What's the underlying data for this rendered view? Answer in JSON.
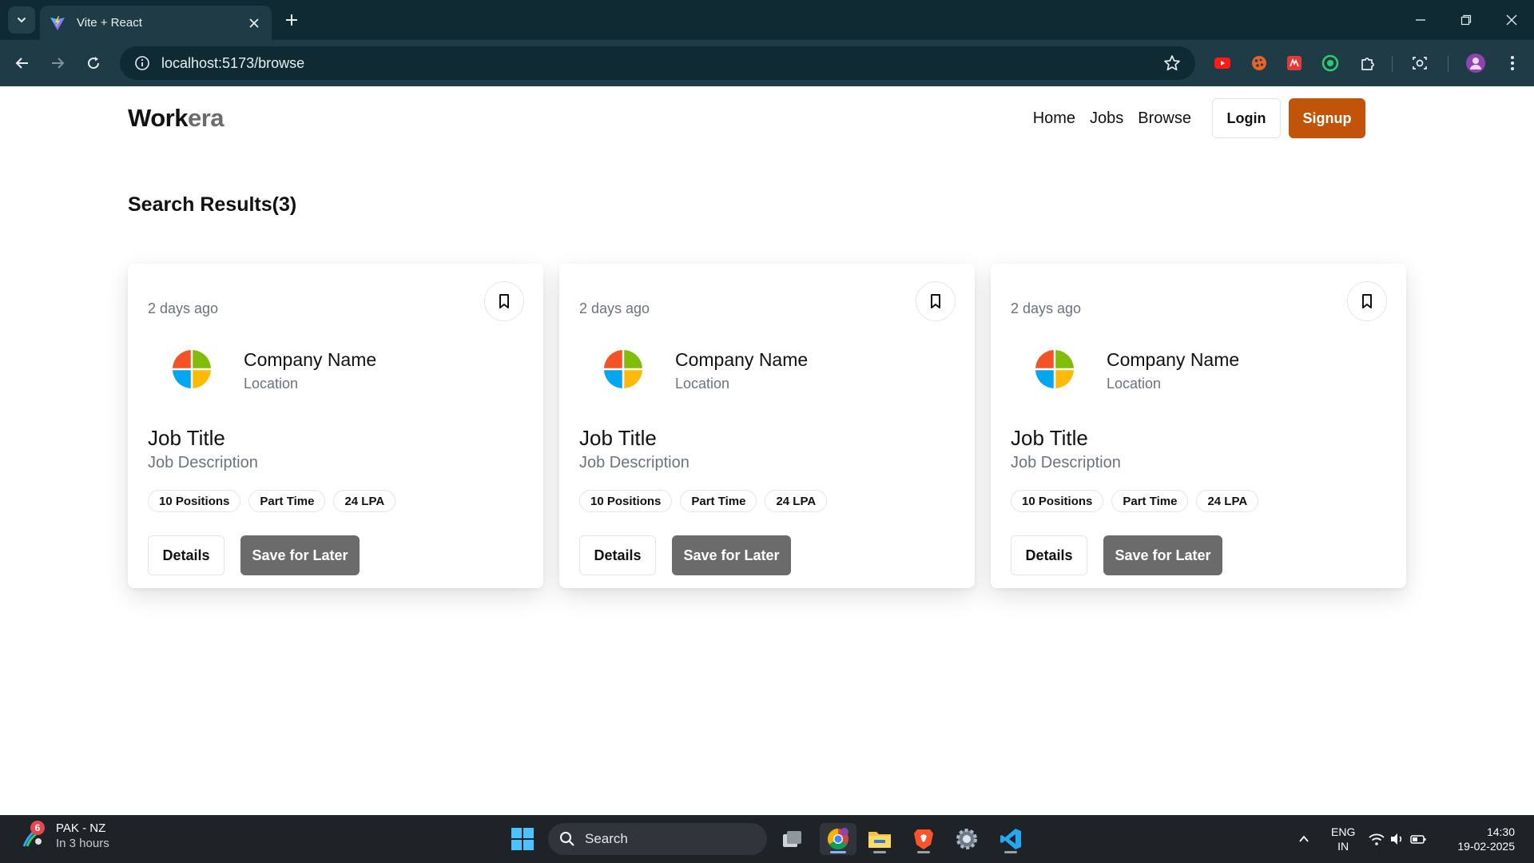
{
  "browser": {
    "tab_title": "Vite + React",
    "url": "localhost:5173/browse"
  },
  "site": {
    "logo_part1": "Work",
    "logo_part2": "era",
    "nav": [
      "Home",
      "Jobs",
      "Browse"
    ],
    "login_label": "Login",
    "signup_label": "Signup",
    "accent_color": "#c2540a"
  },
  "results": {
    "title": "Search Results(3)",
    "cards": [
      {
        "time": "2 days ago",
        "company": "Company Name",
        "location": "Location",
        "job_title": "Job Title",
        "job_description": "Job Description",
        "badges": [
          "10 Positions",
          "Part Time",
          "24 LPA"
        ],
        "details_label": "Details",
        "save_label": "Save for Later"
      },
      {
        "time": "2 days ago",
        "company": "Company Name",
        "location": "Location",
        "job_title": "Job Title",
        "job_description": "Job Description",
        "badges": [
          "10 Positions",
          "Part Time",
          "24 LPA"
        ],
        "details_label": "Details",
        "save_label": "Save for Later"
      },
      {
        "time": "2 days ago",
        "company": "Company Name",
        "location": "Location",
        "job_title": "Job Title",
        "job_description": "Job Description",
        "badges": [
          "10 Positions",
          "Part Time",
          "24 LPA"
        ],
        "details_label": "Details",
        "save_label": "Save for Later"
      }
    ]
  },
  "taskbar": {
    "weather_badge": "6",
    "weather_line1": "PAK - NZ",
    "weather_line2": "In 3 hours",
    "search_label": "Search",
    "lang_line1": "ENG",
    "lang_line2": "IN",
    "time": "14:30",
    "date": "19-02-2025",
    "icons": [
      "windows-start-icon",
      "task-view-icon",
      "chrome-icon",
      "file-explorer-icon",
      "brave-icon",
      "settings-icon",
      "vscode-icon"
    ]
  }
}
